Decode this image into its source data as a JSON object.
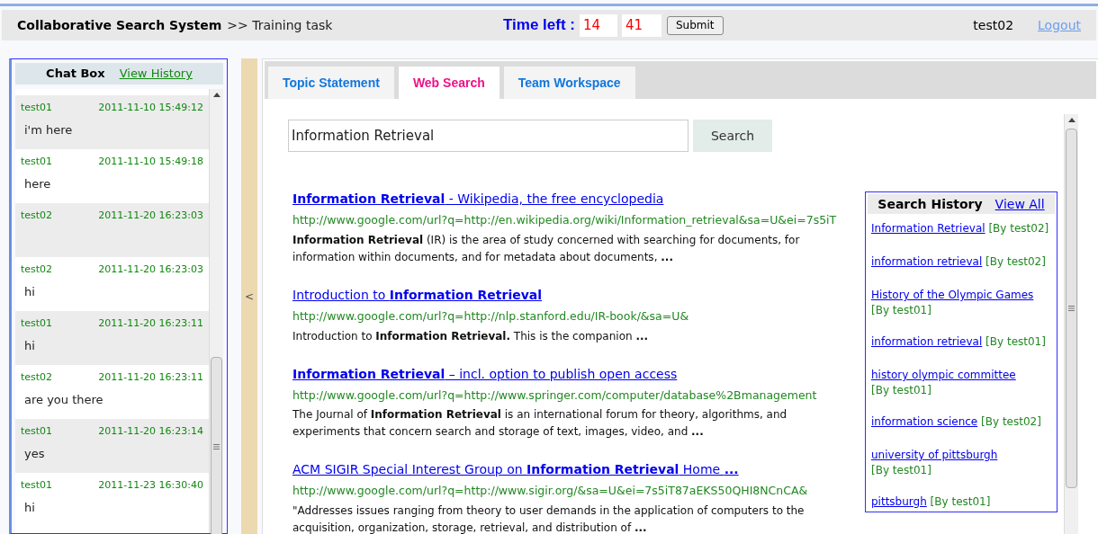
{
  "header": {
    "title": "Collaborative Search System",
    "breadcrumb": ">> Training task",
    "timer_label": "Time left :",
    "minutes": "14",
    "seconds": "41",
    "submit": "Submit",
    "user": "test02",
    "logout": "Logout"
  },
  "chat": {
    "title": "Chat Box",
    "history_link": "View History",
    "messages": [
      {
        "user": "test01",
        "time": "2011-11-10 15:49:12",
        "text": "i'm here"
      },
      {
        "user": "test01",
        "time": "2011-11-10 15:49:18",
        "text": "here"
      },
      {
        "user": "test02",
        "time": "2011-11-20 16:23:03"
      },
      {
        "user": "test02",
        "time": "2011-11-20 16:23:03",
        "text": "hi"
      },
      {
        "user": "test01",
        "time": "2011-11-20 16:23:11",
        "text": "hi"
      },
      {
        "user": "test02",
        "time": "2011-11-20 16:23:11",
        "text": "are you there"
      },
      {
        "user": "test01",
        "time": "2011-11-20 16:23:14",
        "text": "yes"
      },
      {
        "user": "test01",
        "time": "2011-11-23 16:30:40",
        "text": "hi"
      }
    ]
  },
  "splitter": {
    "label": "<"
  },
  "tabs": [
    {
      "label": "Topic Statement",
      "selected": false
    },
    {
      "label": "Web Search",
      "selected": true
    },
    {
      "label": "Team Workspace",
      "selected": false
    }
  ],
  "search": {
    "value": "Information Retrieval",
    "button": "Search"
  },
  "results": [
    {
      "title": "**Information Retrieval** - Wikipedia, the free encyclopedia",
      "url": "http://www.google.com/url?q=http://en.wikipedia.org/wiki/Information_retrieval&sa=U&ei=7s5iT",
      "snippet": "**Information Retrieval** (IR) is the area of study concerned with searching for documents, for information within documents, and for metadata about documents, **...**"
    },
    {
      "title": "Introduction to **Information Retrieval**",
      "url": "http://www.google.com/url?q=http://nlp.stanford.edu/IR-book/&sa=U&",
      "snippet": "Introduction to **Information Retrieval.** This is the companion **...**"
    },
    {
      "title": "**Information Retrieval** – incl. option to publish open access",
      "url": "http://www.google.com/url?q=http://www.springer.com/computer/database%2Bmanagement",
      "snippet": "The Journal of **Information Retrieval** is an international forum for theory, algorithms, and experiments that concern search and storage of text, images, video, and **...**"
    },
    {
      "title": "ACM SIGIR Special Interest Group on **Information Retrieval** Home **...**",
      "url": "http://www.google.com/url?q=http://www.sigir.org/&sa=U&ei=7s5iT87aEKS50QHI8NCnCA&",
      "snippet": "\"Addresses issues ranging from theory to user demands in the application of computers to the acquisition, organization, storage, retrieval, and distribution of **...**"
    }
  ],
  "search_history": {
    "title": "Search History",
    "view_all": "View All",
    "entries": [
      {
        "query": "Information Retrieval",
        "by": "[By test02]"
      },
      {
        "query": "information retrieval",
        "by": "[By test02]"
      },
      {
        "query": "History of the Olympic Games",
        "by": "[By test01]"
      },
      {
        "query": "information retrieval",
        "by": "[By test01]"
      },
      {
        "query": "history olympic committee",
        "by": "[By test01]"
      },
      {
        "query": "information science",
        "by": "[By test02]"
      },
      {
        "query": "university of pittsburgh",
        "by": "[By test01]"
      },
      {
        "query": "pittsburgh",
        "by": "[By test01]"
      }
    ]
  }
}
